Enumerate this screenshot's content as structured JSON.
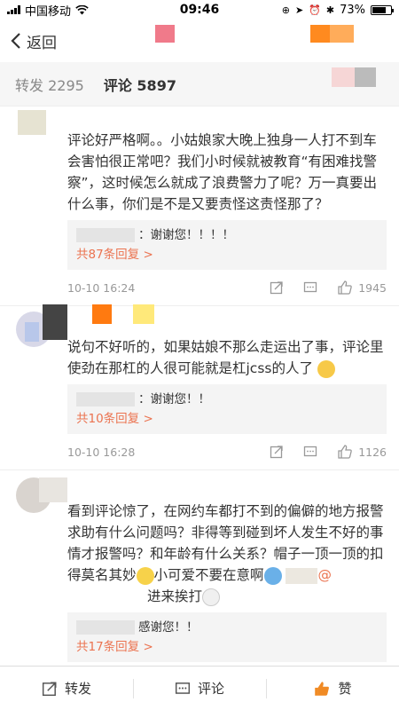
{
  "status_bar": {
    "carrier": "中国移动",
    "time": "09:46",
    "battery": "73%",
    "battery_level": 0.73
  },
  "nav": {
    "back_label": "返回"
  },
  "tabs": [
    {
      "label": "转发",
      "count": "2295"
    },
    {
      "label": "评论",
      "count": "5897"
    }
  ],
  "comments": [
    {
      "text": "评论好严格啊。。小姑娘家大晚上独身一人打不到车会害怕很正常吧？我们小时候就被教育“有困难找警察”，这时候怎么就成了浪费警力了呢？万一真要出什么事，你们是不是又要责怪这责怪那了？",
      "reply_text": "：谢谢您！！！！",
      "reply_more": "共87条回复 >",
      "time": "10-10 16:24",
      "likes": "1945"
    },
    {
      "text": "说句不好听的，如果姑娘不那么走运出了事，评论里使劲在那杠的人很可能就是杠jcss的人了",
      "reply_text": "：谢谢您！！",
      "reply_more": "共10条回复 >",
      "time": "10-10 16:28",
      "likes": "1126"
    },
    {
      "text": "看到评论惊了，在网约车都打不到的偏僻的地方报警求助有什么问题吗？非得等到碰到坏人发生不好的事情才报警吗？和年龄有什么关系？帽子一顶一顶的扣得莫名其妙",
      "text_tail": "小可爱不要在意啊",
      "text_tail2": "@",
      "text_line5": "进来挨打",
      "reply_text": "感谢您！！",
      "reply_more": "共17条回复 >"
    }
  ],
  "bottom_bar": {
    "repost": "转发",
    "comment": "评论",
    "like": "赞"
  },
  "colors": {
    "accent": "#eb7350",
    "like_orange": "#f08a24"
  }
}
